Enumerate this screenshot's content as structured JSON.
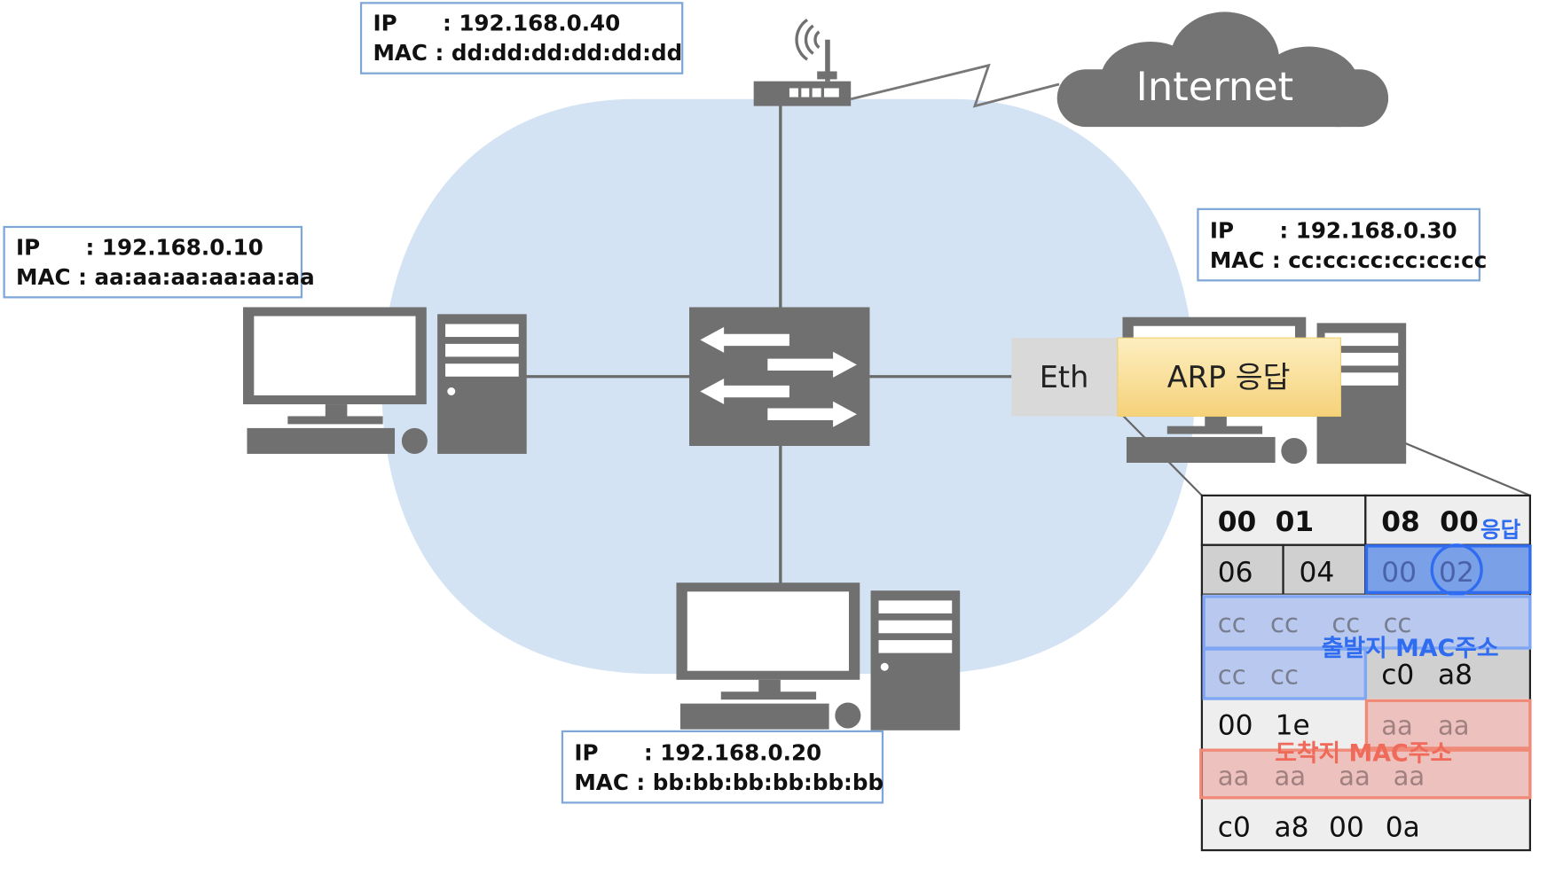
{
  "router": {
    "ip_label": "IP      : 192.168.0.40",
    "mac_label": "MAC : dd:dd:dd:dd:dd:dd"
  },
  "host_a": {
    "ip_label": "IP      : 192.168.0.10",
    "mac_label": "MAC : aa:aa:aa:aa:aa:aa"
  },
  "host_b": {
    "ip_label": "IP      : 192.168.0.20",
    "mac_label": "MAC : bb:bb:bb:bb:bb:bb"
  },
  "host_c": {
    "ip_label": "IP      : 192.168.0.30",
    "mac_label": "MAC : cc:cc:cc:cc:cc:cc"
  },
  "internet": {
    "label": "Internet"
  },
  "frame": {
    "eth_label": "Eth",
    "payload_label": "ARP 응답"
  },
  "packet": {
    "row1": [
      "00",
      "01",
      "08",
      "00"
    ],
    "row2": [
      "06",
      "04",
      "00",
      "02"
    ],
    "row3": [
      "cc",
      "cc",
      "cc",
      "cc"
    ],
    "row4": [
      "cc",
      "cc",
      "c0",
      "a8"
    ],
    "row5": [
      "00",
      "1e",
      "aa",
      "aa"
    ],
    "row6": [
      "aa",
      "aa",
      "aa",
      "aa"
    ],
    "row7": [
      "c0",
      "a8",
      "00",
      "0a"
    ],
    "opcode_note": "응답",
    "sender_mac_note": "출발지 MAC주소",
    "target_mac_note": "도착지 MAC주소"
  },
  "colors": {
    "network": "#d4e3f3",
    "device": "#707070",
    "sender_highlight": "#2f6cf0",
    "target_highlight": "#f07a6a",
    "payload": "#f8dc8a"
  }
}
